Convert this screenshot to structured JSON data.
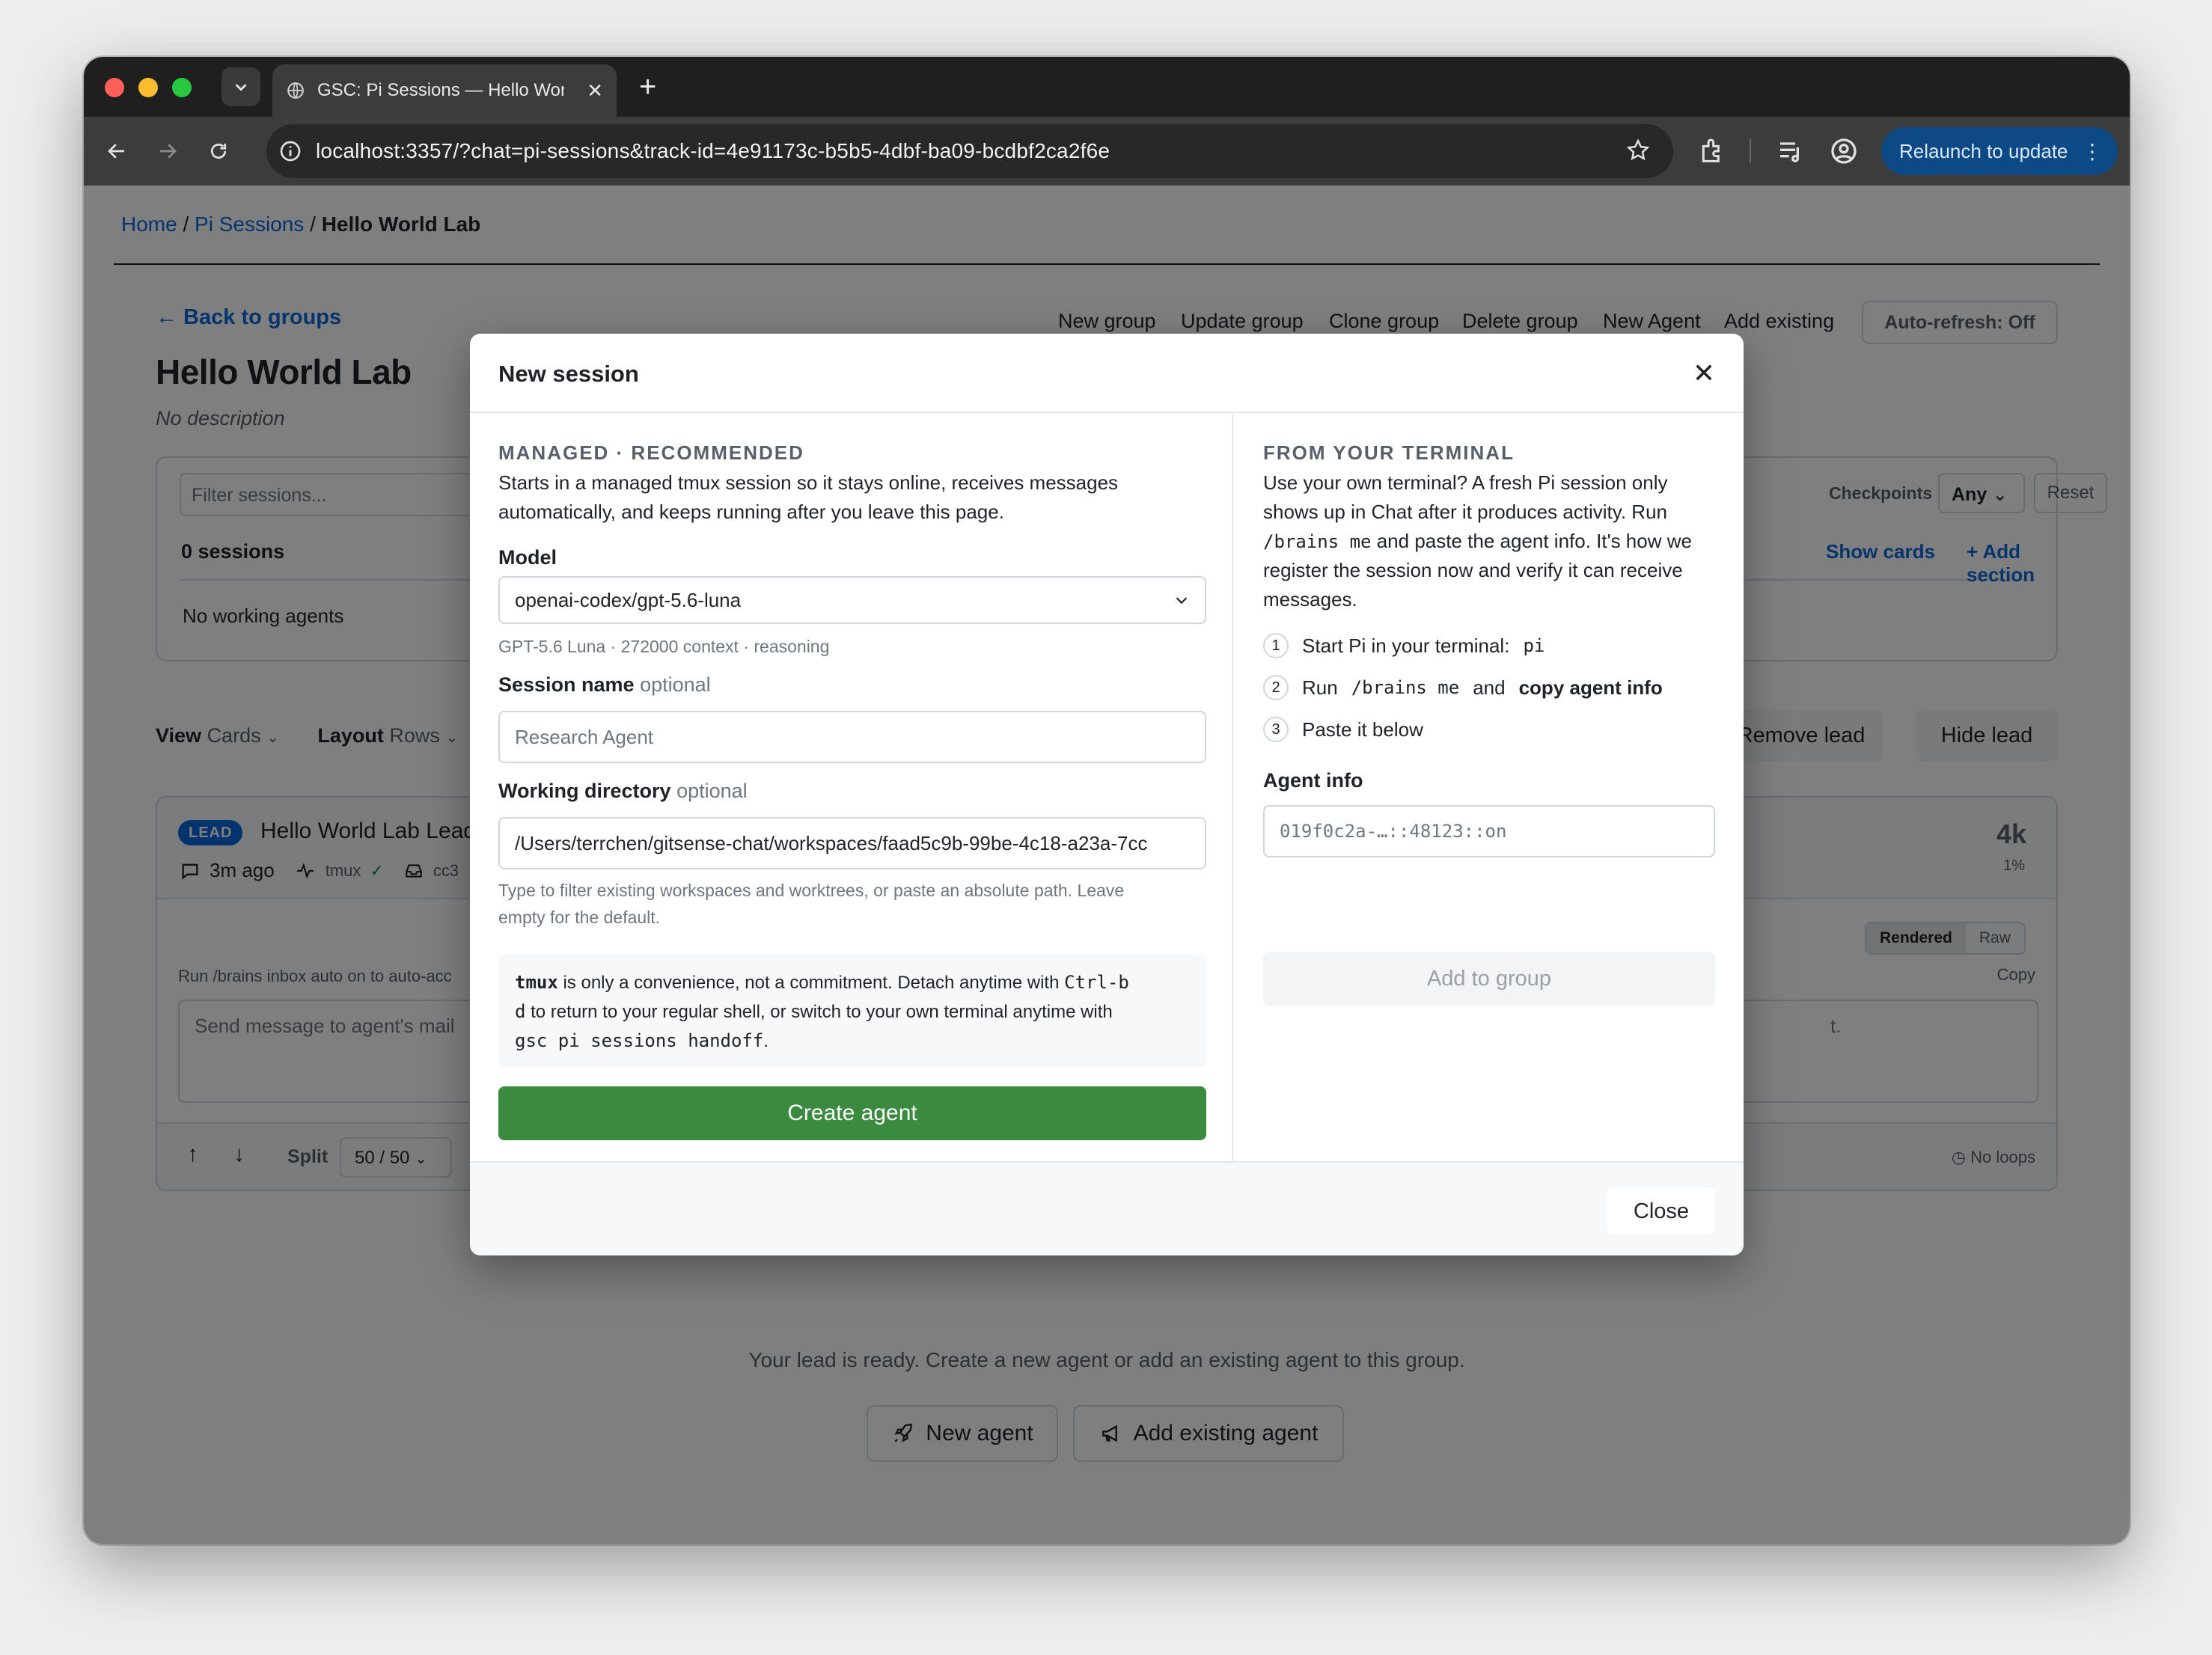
{
  "browser": {
    "tab_title": "GSC: Pi Sessions — Hello World Lab",
    "url": "localhost:3357/?chat=pi-sessions&track-id=4e91173c-b5b5-4dbf-ba09-bcdbf2ca2f6e",
    "relaunch_label": "Relaunch to update"
  },
  "breadcrumb": {
    "home": "Home",
    "sep": "/",
    "section": "Pi Sessions",
    "current": "Hello World Lab"
  },
  "header": {
    "back": "← Back to groups",
    "title": "Hello World Lab",
    "description": "No description",
    "actions": [
      "New group",
      "Update group",
      "Clone group",
      "Delete group",
      "New Agent",
      "Add existing"
    ],
    "auto_refresh": "Auto-refresh: Off"
  },
  "filter": {
    "placeholder": "Filter sessions...",
    "count": "0 sessions",
    "no_working": "No working agents",
    "checkpoints_label": "Checkpoints",
    "checkpoints_value": "Any",
    "reset": "Reset",
    "show_cards": "Show cards",
    "add_section": "+ Add section"
  },
  "viewrow": {
    "view_label": "View",
    "view_value": "Cards",
    "layout_label": "Layout",
    "layout_value": "Rows",
    "remove_lead": "Remove lead",
    "hide_lead": "Hide lead"
  },
  "lead_card": {
    "badge": "LEAD",
    "title": "Hello World Lab Lead",
    "time": "3m ago",
    "tmux": "tmux",
    "mailbox": "cc3",
    "tokens": "4k",
    "percent": "1%",
    "run_hint": "Run /brains inbox auto on to auto-acc",
    "message_placeholder": "Send message to agent's mail",
    "message_tail": "t.",
    "rendered": "Rendered",
    "raw": "Raw",
    "copy": "Copy",
    "split_label": "Split",
    "split_value": "50 / 50",
    "no_loops": "No loops"
  },
  "empty_state": {
    "text": "Your lead is ready. Create a new agent or add an existing agent to this group.",
    "new_agent": "New agent",
    "add_existing": "Add existing agent"
  },
  "modal": {
    "title": "New session",
    "managed": {
      "heading": "MANAGED · RECOMMENDED",
      "desc1": "Starts in a managed tmux session so it stays online, receives messages",
      "desc2": "automatically, and keeps running after you leave this page.",
      "model_label": "Model",
      "model_value": "openai-codex/gpt-5.6-luna",
      "model_hint": "GPT-5.6 Luna · 272000 context · reasoning",
      "name_label": "Session name",
      "optional": "optional",
      "name_placeholder": "Research Agent",
      "dir_label": "Working directory",
      "dir_value": "/Users/terrchen/gitsense-chat/workspaces/faad5c9b-99be-4c18-a23a-7cc",
      "dir_hint1": "Type to filter existing workspaces and worktrees, or paste an absolute path. Leave",
      "dir_hint2": "empty for the default.",
      "tmux_b": "tmux",
      "tmux_t1": " is only a convenience, not a commitment. Detach anytime with ",
      "tmux_c1": "Ctrl-b",
      "tmux_c2": "d",
      "tmux_t2": " to return to your regular shell, or switch to your own terminal anytime with",
      "tmux_c3": "gsc pi sessions handoff",
      "tmux_t3": ".",
      "create": "Create agent"
    },
    "terminal": {
      "heading": "FROM YOUR TERMINAL",
      "p1": "Use your own terminal? A fresh Pi session only",
      "p2": "shows up in Chat after it produces activity. Run",
      "p3_code": "/brains me",
      "p3": " and paste the agent info. It's how we",
      "p4": "register the session now and verify it can receive",
      "p5": "messages.",
      "step1": "Start Pi in your terminal:",
      "step1_code": "pi",
      "step2_a": "Run",
      "step2_code": "/brains me",
      "step2_b": "and",
      "step2_c": "copy agent info",
      "step3": "Paste it below",
      "agent_info_label": "Agent info",
      "agent_info_placeholder": "019f0c2a-…::48123::on",
      "add_to_group": "Add to group"
    },
    "close": "Close"
  }
}
